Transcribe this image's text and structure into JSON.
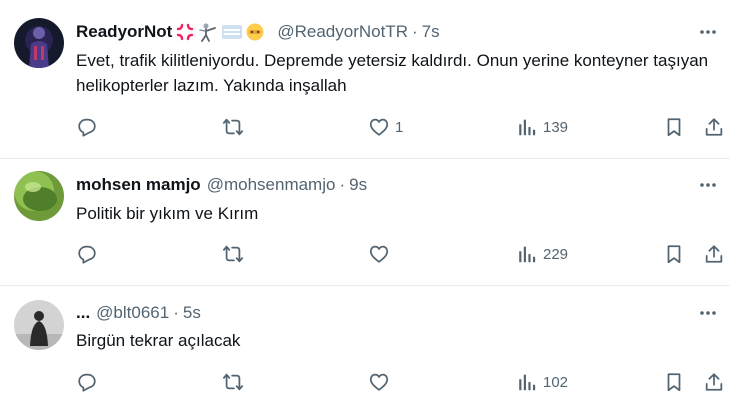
{
  "tweets": [
    {
      "name": "ReadyorNot",
      "handle": "@ReadyorNotTR",
      "separator": "·",
      "time": "7s",
      "text": "Evet, trafik kilitleniyordu. Depremde yetersiz kaldırdı. Onun yerine konteyner taşıyan helikopterler lazım. Yakında inşallah",
      "likes": "1",
      "views": "139"
    },
    {
      "name": "mohsen mamjo",
      "handle": "@mohsenmamjo",
      "separator": "·",
      "time": "9s",
      "text": "Politik bir yıkım ve Kırım",
      "likes": "",
      "views": "229"
    },
    {
      "name": "...",
      "handle": "@blt0661",
      "separator": "·",
      "time": "5s",
      "text": "Birgün tekrar açılacak",
      "likes": "",
      "views": "102"
    }
  ],
  "colors": {
    "text": "#0f1419",
    "secondary": "#536471",
    "divider": "#e6ecf0",
    "anger_emoji": "#f4245e"
  },
  "icons": {
    "reply": "reply-icon",
    "retweet": "retweet-icon",
    "like": "heart-icon",
    "views": "analytics-icon",
    "bookmark": "bookmark-icon",
    "share": "share-icon",
    "more": "more-icon"
  }
}
